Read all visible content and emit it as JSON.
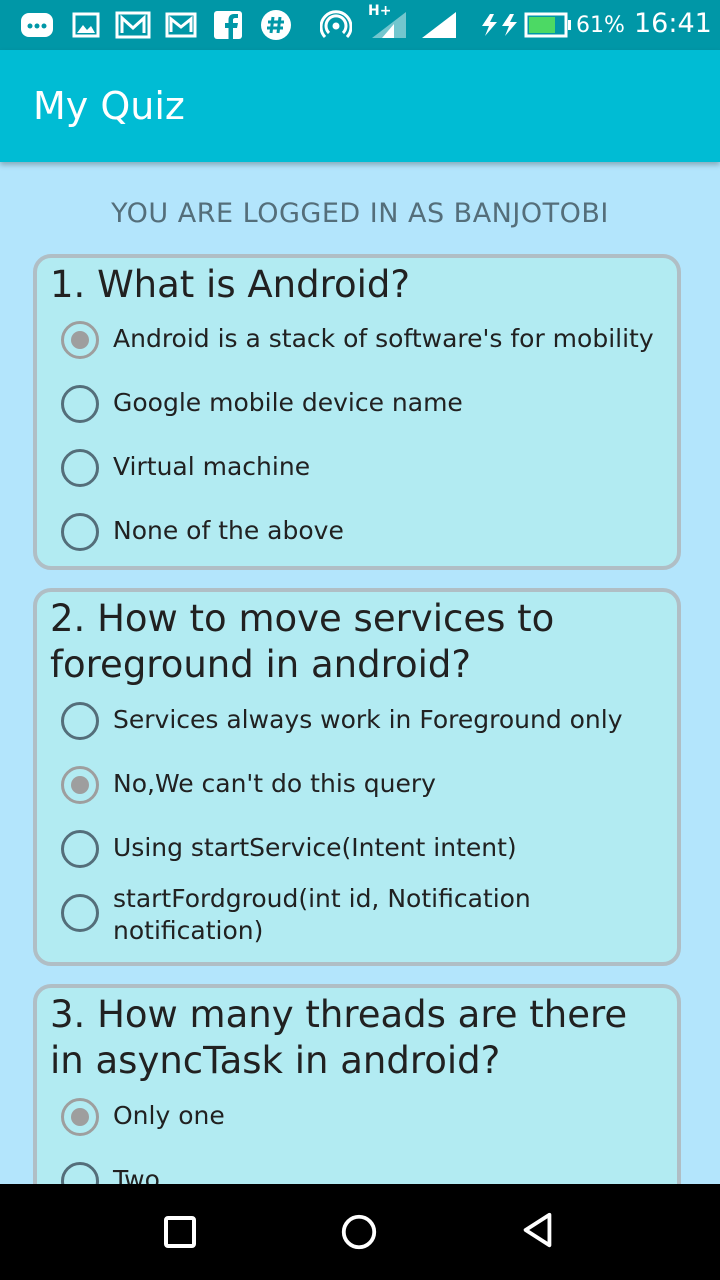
{
  "status_bar": {
    "network_type": "H+",
    "battery_percent": "61%",
    "time": "16:41",
    "icons": [
      "more-icon",
      "gallery-icon",
      "email-icon",
      "gmail-icon",
      "facebook-icon",
      "hashtag-icon",
      "hotspot-icon",
      "signal-icon",
      "signal-icon",
      "charging-icon",
      "battery-icon"
    ]
  },
  "app_bar": {
    "title": "My Quiz"
  },
  "login": {
    "text": "YOU ARE LOGGED IN AS BANJOTOBI"
  },
  "questions": [
    {
      "text": "1. What is Android?",
      "options": [
        {
          "label": "Android is a stack of software's for mobility",
          "checked": true
        },
        {
          "label": "Google mobile device name",
          "checked": false
        },
        {
          "label": "Virtual machine",
          "checked": false
        },
        {
          "label": "None of the above",
          "checked": false
        }
      ]
    },
    {
      "text": "2. How to move services to foreground in android?",
      "options": [
        {
          "label": "Services always work in Foreground only",
          "checked": false
        },
        {
          "label": "No,We can't do this query",
          "checked": true
        },
        {
          "label": "Using startService(Intent intent)",
          "checked": false
        },
        {
          "label": "startFordgroud(int id, Notification notification)",
          "checked": false
        }
      ]
    },
    {
      "text": "3. How many threads are there in asyncTask in android?",
      "options": [
        {
          "label": "Only one",
          "checked": true
        },
        {
          "label": "Two",
          "checked": false
        }
      ]
    }
  ],
  "colors": {
    "status_bar": "#0097a7",
    "app_bar": "#00bcd4",
    "background": "#b3e5fc",
    "card": "#b2ebf2",
    "card_border": "#b0bec5"
  }
}
